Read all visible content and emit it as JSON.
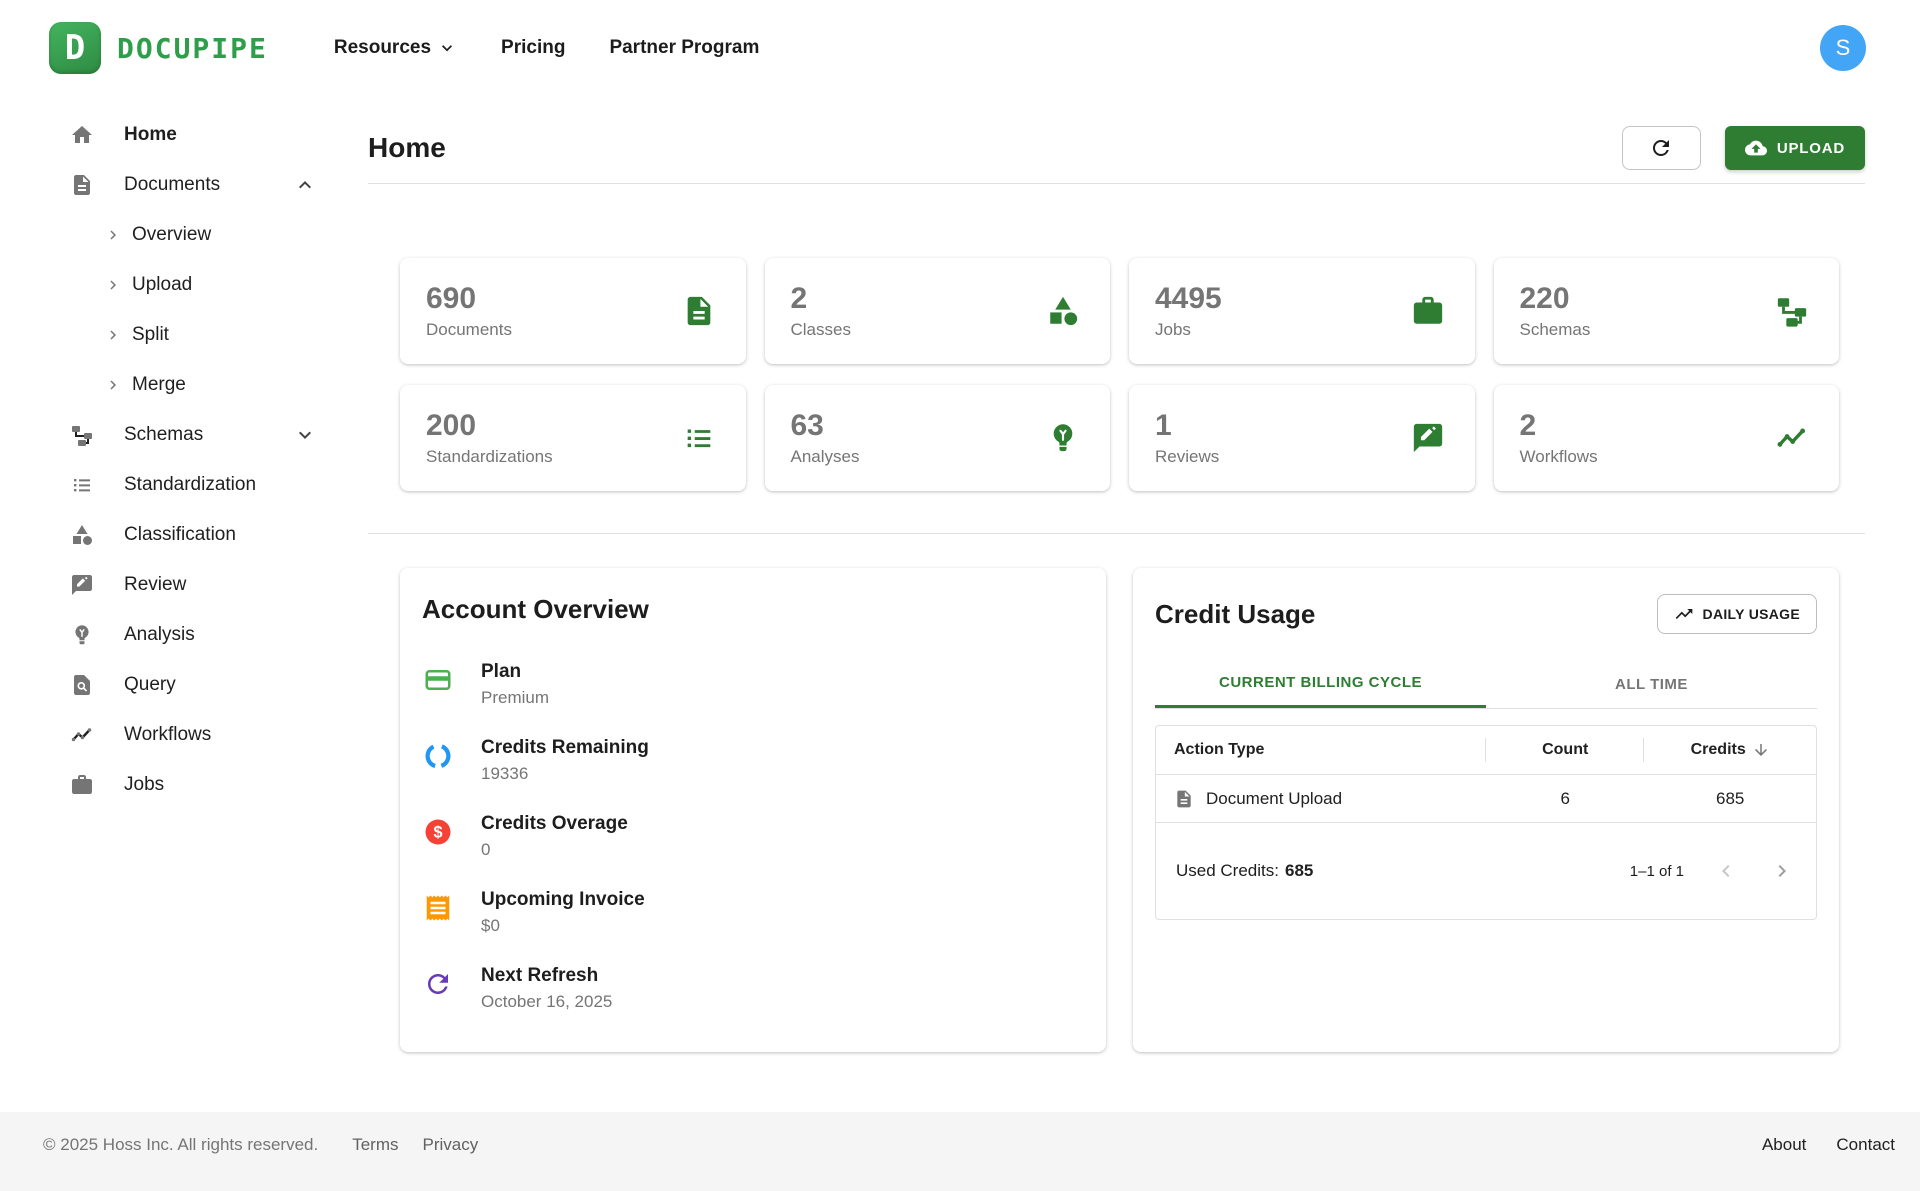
{
  "nav": {
    "brand": "DOCUPIPE",
    "items": [
      {
        "label": "Resources",
        "has_dropdown": true
      },
      {
        "label": "Pricing"
      },
      {
        "label": "Partner Program"
      }
    ],
    "avatar_initial": "S"
  },
  "sidebar": {
    "items": [
      {
        "label": "Home",
        "icon": "home-icon",
        "active": true
      },
      {
        "label": "Documents",
        "icon": "document-icon",
        "expanded": true,
        "children": [
          {
            "label": "Overview"
          },
          {
            "label": "Upload"
          },
          {
            "label": "Split"
          },
          {
            "label": "Merge"
          }
        ]
      },
      {
        "label": "Schemas",
        "icon": "schema-icon",
        "expanded": false
      },
      {
        "label": "Standardization",
        "icon": "list-icon"
      },
      {
        "label": "Classification",
        "icon": "category-icon"
      },
      {
        "label": "Review",
        "icon": "rate-review-icon"
      },
      {
        "label": "Analysis",
        "icon": "lightbulb-icon"
      },
      {
        "label": "Query",
        "icon": "document-search-icon"
      },
      {
        "label": "Workflows",
        "icon": "trending-icon"
      },
      {
        "label": "Jobs",
        "icon": "briefcase-icon"
      }
    ]
  },
  "page": {
    "title": "Home",
    "upload_label": "UPLOAD"
  },
  "stats": [
    {
      "value": "690",
      "label": "Documents",
      "icon": "document-icon"
    },
    {
      "value": "2",
      "label": "Classes",
      "icon": "category-icon"
    },
    {
      "value": "4495",
      "label": "Jobs",
      "icon": "briefcase-icon"
    },
    {
      "value": "220",
      "label": "Schemas",
      "icon": "schema-icon"
    },
    {
      "value": "200",
      "label": "Standardizations",
      "icon": "list-icon"
    },
    {
      "value": "63",
      "label": "Analyses",
      "icon": "lightbulb-icon"
    },
    {
      "value": "1",
      "label": "Reviews",
      "icon": "rate-review-icon"
    },
    {
      "value": "2",
      "label": "Workflows",
      "icon": "trending-icon"
    }
  ],
  "account": {
    "title": "Account Overview",
    "items": [
      {
        "label": "Plan",
        "value": "Premium",
        "icon": "credit-card-icon",
        "color": "#4caf50"
      },
      {
        "label": "Credits Remaining",
        "value": "19336",
        "icon": "data-usage-icon",
        "color": "#2196f3"
      },
      {
        "label": "Credits Overage",
        "value": "0",
        "icon": "dollar-icon",
        "color": "#f44336"
      },
      {
        "label": "Upcoming Invoice",
        "value": "$0",
        "icon": "receipt-icon",
        "color": "#ff9800"
      },
      {
        "label": "Next Refresh",
        "value": "October 16, 2025",
        "icon": "refresh-icon",
        "color": "#673ab7"
      }
    ]
  },
  "credit_usage": {
    "title": "Credit Usage",
    "daily_usage_label": "DAILY USAGE",
    "tabs": [
      {
        "label": "CURRENT BILLING CYCLE",
        "active": true
      },
      {
        "label": "ALL TIME",
        "active": false
      }
    ],
    "table": {
      "headers": [
        "Action Type",
        "Count",
        "Credits"
      ],
      "sorted_by": "Credits",
      "rows": [
        {
          "action": "Document Upload",
          "count": "6",
          "credits": "685",
          "icon": "document-icon"
        }
      ]
    },
    "used_credits_label": "Used Credits:",
    "used_credits_value": "685",
    "pagination_range": "1–1 of 1"
  },
  "footer": {
    "copyright": "© 2025 Hoss Inc. All rights reserved.",
    "links": [
      {
        "label": "Terms"
      },
      {
        "label": "Privacy"
      }
    ],
    "right_links": [
      {
        "label": "About"
      },
      {
        "label": "Contact"
      }
    ]
  },
  "colors": {
    "brand_green": "#2f9e4a",
    "primary_green": "#2e7d32",
    "avatar_blue": "#42a5f5",
    "plan_icon_green": "#4caf50",
    "credits_icon_blue": "#2196f3",
    "overage_icon_red": "#f44336",
    "invoice_icon_orange": "#ff9800",
    "refresh_icon_purple": "#673ab7",
    "footer_bg": "#f5f5f5"
  }
}
